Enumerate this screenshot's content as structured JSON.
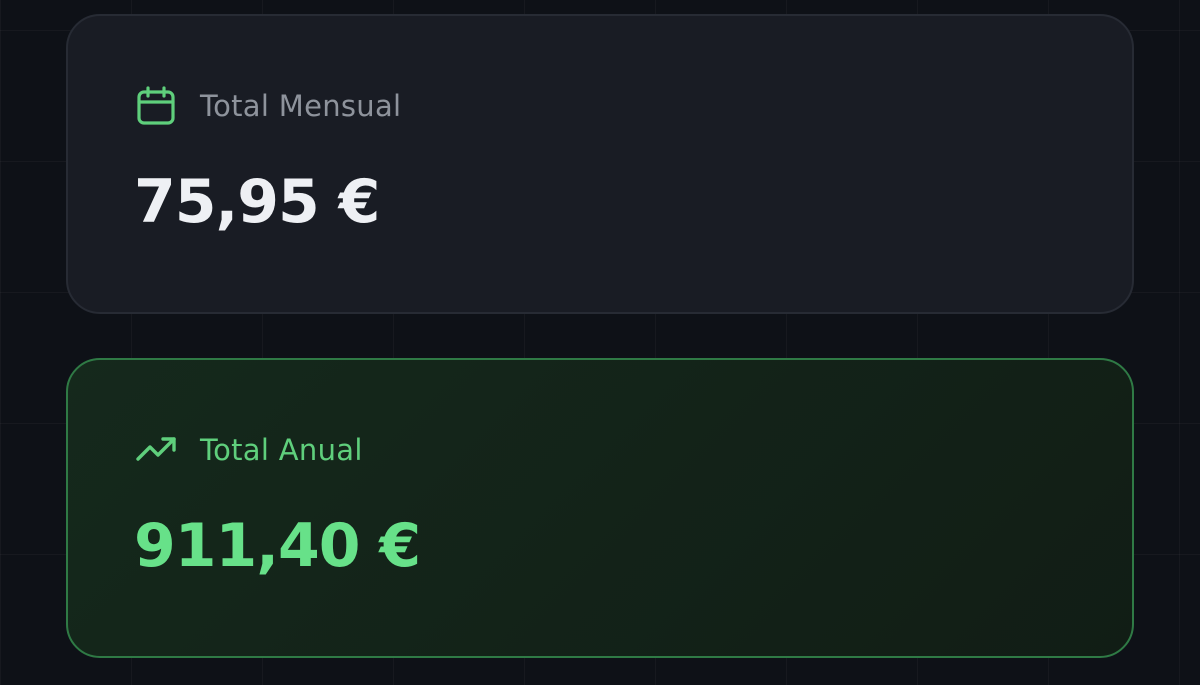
{
  "monthly": {
    "icon": "calendar-icon",
    "label": "Total Mensual",
    "amount": "75,95 €"
  },
  "annual": {
    "icon": "trending-up-icon",
    "label": "Total Anual",
    "amount": "911,40 €"
  },
  "colors": {
    "background": "#0e1117",
    "card": "#191c24",
    "accent_green": "#67e189",
    "label_gray": "#8e939c",
    "amount_white": "#eef0f4"
  }
}
